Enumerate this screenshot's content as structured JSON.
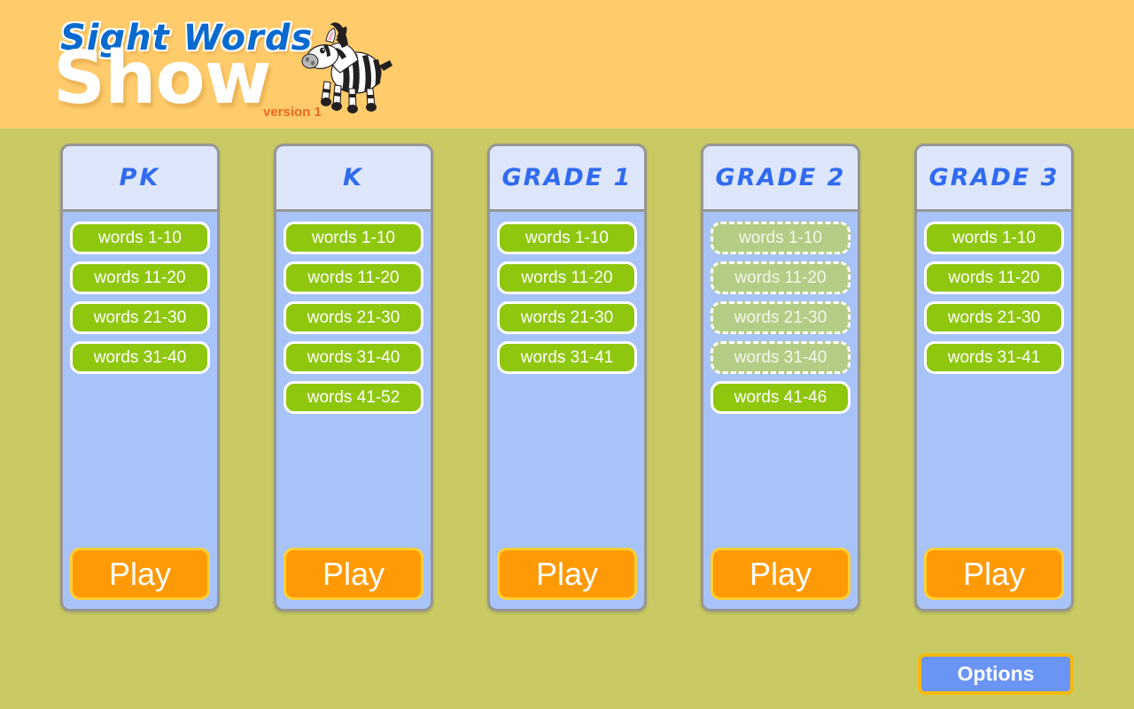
{
  "header": {
    "logo_line1": "Sight Words",
    "logo_line2": "Show",
    "version": "version 1",
    "mascot": "zebra-mascot",
    "band_color": "#ffcb6b",
    "logo_blue": "#0a6ad0",
    "version_color": "#ea6a1e"
  },
  "page": {
    "background_color": "#c9ca63"
  },
  "colors": {
    "card_body": "#a8c3f7",
    "card_header": "#dde6fb",
    "card_border": "#969696",
    "word_button": "#8fc70f",
    "word_button_done": "#b4cd86",
    "play_button": "#ff9a07",
    "play_button_border": "#ffcf33",
    "options_button": "#6a94f6",
    "options_button_border": "#f7b90c",
    "title_blue": "#2f6af0"
  },
  "cards": [
    {
      "title": "PK",
      "play_label": "Play",
      "levels": [
        {
          "label": "words 1-10",
          "done": false
        },
        {
          "label": "words 11-20",
          "done": false
        },
        {
          "label": "words 21-30",
          "done": false
        },
        {
          "label": "words 31-40",
          "done": false
        }
      ]
    },
    {
      "title": "K",
      "play_label": "Play",
      "levels": [
        {
          "label": "words 1-10",
          "done": false
        },
        {
          "label": "words 11-20",
          "done": false
        },
        {
          "label": "words 21-30",
          "done": false
        },
        {
          "label": "words 31-40",
          "done": false
        },
        {
          "label": "words 41-52",
          "done": false
        }
      ]
    },
    {
      "title": "GRADE 1",
      "play_label": "Play",
      "levels": [
        {
          "label": "words 1-10",
          "done": false
        },
        {
          "label": "words 11-20",
          "done": false
        },
        {
          "label": "words 21-30",
          "done": false
        },
        {
          "label": "words 31-41",
          "done": false
        }
      ]
    },
    {
      "title": "GRADE 2",
      "play_label": "Play",
      "levels": [
        {
          "label": "words 1-10",
          "done": true
        },
        {
          "label": "words 11-20",
          "done": true
        },
        {
          "label": "words 21-30",
          "done": true
        },
        {
          "label": "words 31-40",
          "done": true
        },
        {
          "label": "words 41-46",
          "done": false
        }
      ]
    },
    {
      "title": "GRADE 3",
      "play_label": "Play",
      "levels": [
        {
          "label": "words 1-10",
          "done": false
        },
        {
          "label": "words 11-20",
          "done": false
        },
        {
          "label": "words 21-30",
          "done": false
        },
        {
          "label": "words 31-41",
          "done": false
        }
      ]
    }
  ],
  "options": {
    "label": "Options"
  }
}
